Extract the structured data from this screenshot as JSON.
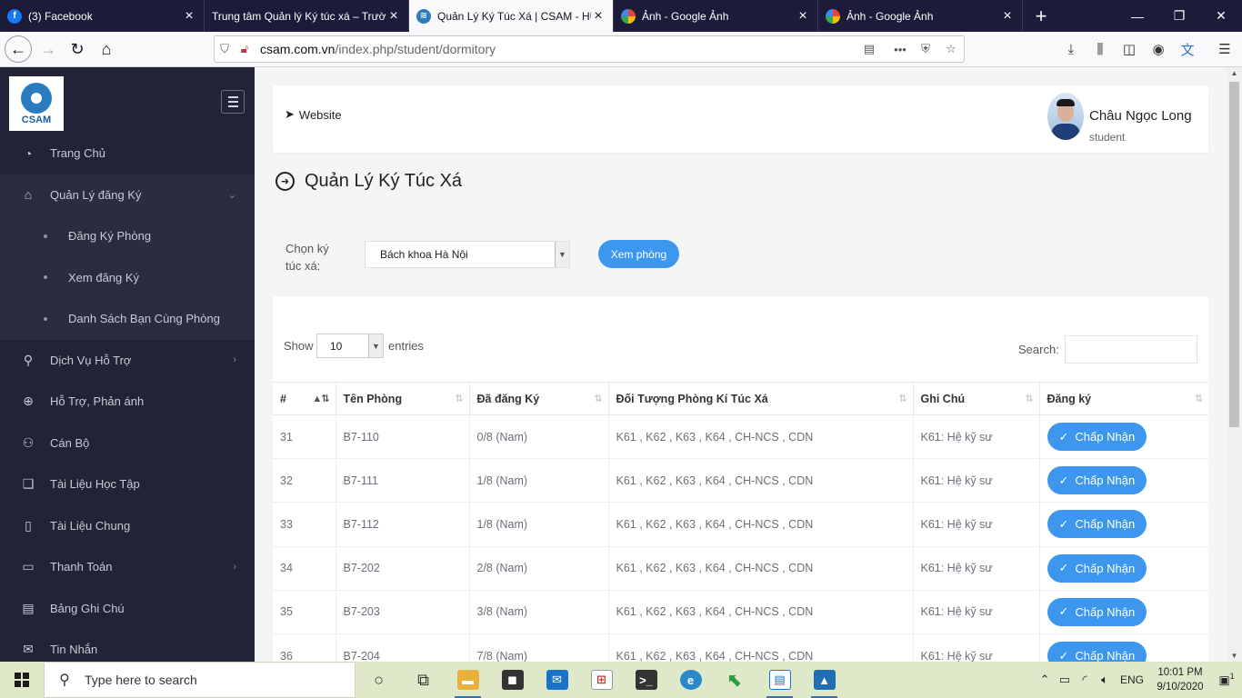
{
  "browser": {
    "tabs": [
      {
        "title": "(3) Facebook",
        "icon": "facebook-icon",
        "color": "#1877f2",
        "glyph": "f",
        "active": false
      },
      {
        "title": "Trung tâm Quản lý Ký túc xá – Trườ",
        "icon": "",
        "color": "",
        "glyph": "",
        "active": false
      },
      {
        "title": "Quản Lý Ký Túc Xá | CSAM - HU",
        "icon": "graduation-cap-icon",
        "color": "#2b7bbf",
        "glyph": "≋",
        "active": true
      },
      {
        "title": "Ảnh - Google Ảnh",
        "icon": "google-photos-icon",
        "color": "#ea4335",
        "glyph": "✿",
        "active": false
      },
      {
        "title": "Ảnh - Google Ảnh",
        "icon": "google-photos-icon",
        "color": "#ea4335",
        "glyph": "✿",
        "active": false
      }
    ],
    "url_domain": "csam.com.vn",
    "url_path": "/index.php/student/dormitory"
  },
  "sidebar": {
    "logo_text": "CSAM",
    "items": [
      {
        "label": "Trang Chủ",
        "icon": "dashboard-icon",
        "glyph": "◔",
        "chevron": ""
      },
      {
        "label": "Quản Lý đăng Ký",
        "icon": "home-icon",
        "glyph": "⌂",
        "chevron": "⌄",
        "open": true
      },
      {
        "label": "Đăng Ký Phòng",
        "sub": true
      },
      {
        "label": "Xem đăng Ký",
        "sub": true
      },
      {
        "label": "Danh Sách Bạn Cùng Phòng",
        "sub": true
      },
      {
        "label": "Dịch Vụ Hỗ Trợ",
        "icon": "map-pin-icon",
        "glyph": "⚲",
        "chevron": "›"
      },
      {
        "label": "Hỗ Trợ, Phản ánh",
        "icon": "crosshair-icon",
        "glyph": "⊕",
        "chevron": ""
      },
      {
        "label": "Cán Bộ",
        "icon": "users-icon",
        "glyph": "👥",
        "chevron": ""
      },
      {
        "label": "Tài Liệu Học Tập",
        "icon": "book-icon",
        "glyph": "📖",
        "chevron": ""
      },
      {
        "label": "Tài Liệu Chung",
        "icon": "mobile-icon",
        "glyph": "▯",
        "chevron": ""
      },
      {
        "label": "Thanh Toán",
        "icon": "credit-card-icon",
        "glyph": "▭",
        "chevron": "›"
      },
      {
        "label": "Bảng Ghi Chú",
        "icon": "note-icon",
        "glyph": "▤",
        "chevron": ""
      },
      {
        "label": "Tin Nhắn",
        "icon": "mail-icon",
        "glyph": "✉",
        "chevron": ""
      }
    ]
  },
  "header": {
    "website_label": "Website",
    "user_name": "Châu Ngọc Long",
    "user_role": "student"
  },
  "page": {
    "title": "Quản Lý Ký Túc Xá",
    "choose_label": "Chọn ký túc xá:",
    "dorm_selected": "Bách khoa Hà Nội",
    "view_button": "Xem phòng"
  },
  "table": {
    "show_label": "Show",
    "entries_value": "10",
    "entries_label": "entries",
    "search_label": "Search:",
    "columns": [
      "#",
      "Tên Phòng",
      "Đã đăng Ký",
      "Đối Tượng Phòng Kí Túc Xá",
      "Ghi Chú",
      "Đăng ký"
    ],
    "accept_label": "Chấp Nhận",
    "rows": [
      {
        "id": "31",
        "room": "B7-110",
        "registered": "0/8 (Nam)",
        "target": "K61 , K62 , K63 , K64 , CH-NCS , CDN",
        "note": "K61: Hệ kỹ sư"
      },
      {
        "id": "32",
        "room": "B7-111",
        "registered": "1/8 (Nam)",
        "target": "K61 , K62 , K63 , K64 , CH-NCS , CDN",
        "note": "K61: Hệ kỹ sư"
      },
      {
        "id": "33",
        "room": "B7-112",
        "registered": "1/8 (Nam)",
        "target": "K61 , K62 , K63 , K64 , CH-NCS , CDN",
        "note": "K61: Hệ kỹ sư"
      },
      {
        "id": "34",
        "room": "B7-202",
        "registered": "2/8 (Nam)",
        "target": "K61 , K62 , K63 , K64 , CH-NCS , CDN",
        "note": "K61: Hệ kỹ sư"
      },
      {
        "id": "35",
        "room": "B7-203",
        "registered": "3/8 (Nam)",
        "target": "K61 , K62 , K63 , K64 , CH-NCS , CDN",
        "note": "K61: Hệ kỹ sư"
      },
      {
        "id": "36",
        "room": "B7-204",
        "registered": "7/8 (Nam)",
        "target": "K61 , K62 , K63 , K64 , CH-NCS , CDN",
        "note": "K61: Hệ kỹ sư"
      }
    ]
  },
  "taskbar": {
    "search_placeholder": "Type here to search",
    "language": "ENG",
    "time": "10:01 PM",
    "date": "9/10/2020",
    "notification_count": "1"
  },
  "colors": {
    "accent": "#3d97ef",
    "sidebar_bg": "#222336",
    "tabbar_bg": "#1c1b3a",
    "taskbar_bg": "#dfe8c9"
  }
}
